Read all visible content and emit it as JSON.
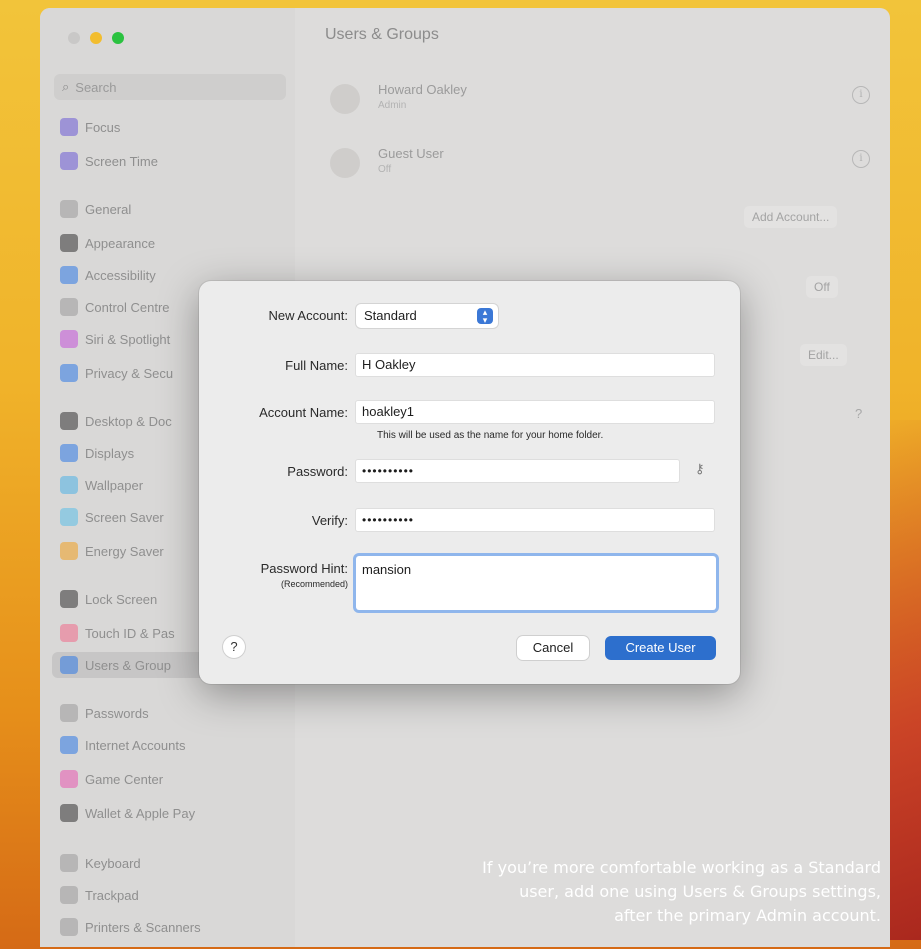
{
  "window": {
    "title": "Users & Groups"
  },
  "search": {
    "placeholder": "Search"
  },
  "sidebar": {
    "items": [
      {
        "label": "Focus",
        "icon": "focus-icon",
        "color": "#6b5bd6"
      },
      {
        "label": "Screen Time",
        "icon": "screen-time-icon",
        "color": "#6b5bd6"
      },
      {
        "label": "General",
        "icon": "gear-icon",
        "color": "#9a9a9a"
      },
      {
        "label": "Appearance",
        "icon": "appearance-icon",
        "color": "#333333"
      },
      {
        "label": "Accessibility",
        "icon": "accessibility-icon",
        "color": "#2f7ae5"
      },
      {
        "label": "Control Centre",
        "icon": "control-centre-icon",
        "color": "#9a9a9a"
      },
      {
        "label": "Siri & Spotlight",
        "icon": "siri-icon",
        "color": "#c254d9"
      },
      {
        "label": "Privacy & Secu",
        "icon": "privacy-icon",
        "color": "#2f7ae5"
      },
      {
        "label": "Desktop & Doc",
        "icon": "desktop-dock-icon",
        "color": "#333333"
      },
      {
        "label": "Displays",
        "icon": "displays-icon",
        "color": "#2f7ae5"
      },
      {
        "label": "Wallpaper",
        "icon": "wallpaper-icon",
        "color": "#4fb3e5"
      },
      {
        "label": "Screen Saver",
        "icon": "screen-saver-icon",
        "color": "#5bc0e8"
      },
      {
        "label": "Energy Saver",
        "icon": "energy-saver-icon",
        "color": "#f0a020"
      },
      {
        "label": "Lock Screen",
        "icon": "lock-screen-icon",
        "color": "#333333"
      },
      {
        "label": "Touch ID & Pas",
        "icon": "touch-id-icon",
        "color": "#f06b8a"
      },
      {
        "label": "Users & Group",
        "icon": "users-icon",
        "color": "#2f7ae5"
      },
      {
        "label": "Passwords",
        "icon": "passwords-icon",
        "color": "#9a9a9a"
      },
      {
        "label": "Internet Accounts",
        "icon": "internet-accounts-icon",
        "color": "#2f7ae5"
      },
      {
        "label": "Game Center",
        "icon": "game-center-icon",
        "color": "#e85ab0"
      },
      {
        "label": "Wallet & Apple Pay",
        "icon": "wallet-icon",
        "color": "#333333"
      },
      {
        "label": "Keyboard",
        "icon": "keyboard-icon",
        "color": "#9a9a9a"
      },
      {
        "label": "Trackpad",
        "icon": "trackpad-icon",
        "color": "#9a9a9a"
      },
      {
        "label": "Printers & Scanners",
        "icon": "printers-icon",
        "color": "#9a9a9a"
      }
    ]
  },
  "users": [
    {
      "name": "Howard Oakley",
      "role": "Admin"
    },
    {
      "name": "Guest User",
      "role": "Off"
    }
  ],
  "background_buttons": {
    "add_account": "Add Account...",
    "on_off": "Off",
    "edit": "Edit...",
    "help": "?"
  },
  "dialog": {
    "new_account_label": "New Account:",
    "new_account_value": "Standard",
    "full_name_label": "Full Name:",
    "full_name_value": "H Oakley",
    "account_name_label": "Account Name:",
    "account_name_value": "hoakley1",
    "account_name_note": "This will be used as the name for your home folder.",
    "password_label": "Password:",
    "password_value": "••••••••••",
    "verify_label": "Verify:",
    "verify_value": "••••••••••",
    "hint_label": "Password Hint:",
    "hint_sublabel": "(Recommended)",
    "hint_value": "mansion",
    "help": "?",
    "cancel": "Cancel",
    "create": "Create User"
  },
  "caption": "If you’re more comfortable working as a Standard user, add one using Users & Groups settings, after the primary Admin account.",
  "colors": {
    "accent": "#2d6fcd",
    "wallpaper": "#f0b32a"
  }
}
